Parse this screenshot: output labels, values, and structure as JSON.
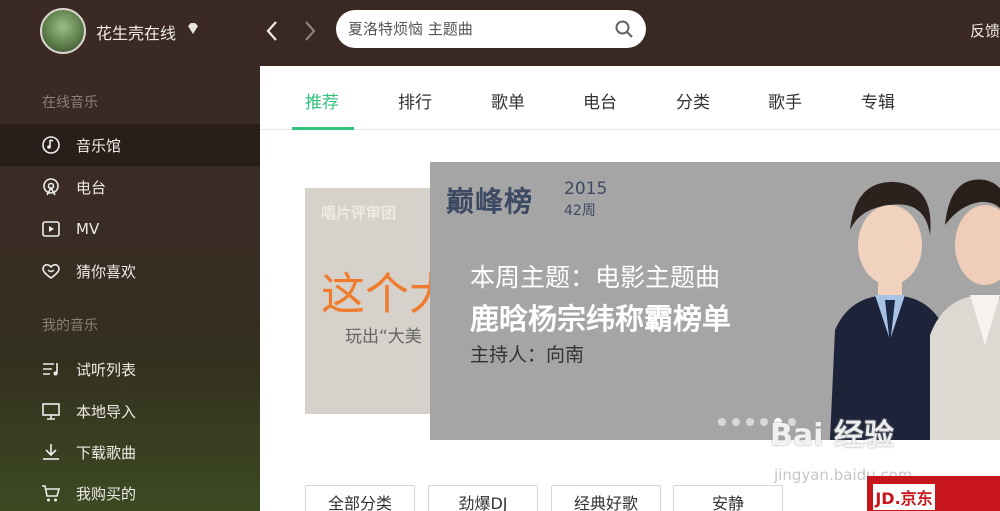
{
  "user": {
    "name": "花生壳在线"
  },
  "sidebar": {
    "sections": [
      {
        "title": "在线音乐",
        "items": [
          {
            "label": "音乐馆",
            "icon": "music-hall-icon",
            "active": true
          },
          {
            "label": "电台",
            "icon": "radio-icon"
          },
          {
            "label": "MV",
            "icon": "mv-icon"
          },
          {
            "label": "猜你喜欢",
            "icon": "heart-icon"
          }
        ]
      },
      {
        "title": "我的音乐",
        "items": [
          {
            "label": "试听列表",
            "icon": "playlist-icon"
          },
          {
            "label": "本地导入",
            "icon": "monitor-icon"
          },
          {
            "label": "下载歌曲",
            "icon": "download-icon"
          },
          {
            "label": "我购买的",
            "icon": "cart-icon"
          }
        ]
      }
    ]
  },
  "search": {
    "placeholder": "夏洛特烦恼 主题曲"
  },
  "header": {
    "feedback": "反馈"
  },
  "tabs": [
    {
      "label": "推荐",
      "active": true
    },
    {
      "label": "排行"
    },
    {
      "label": "歌单"
    },
    {
      "label": "电台"
    },
    {
      "label": "分类"
    },
    {
      "label": "歌手"
    },
    {
      "label": "专辑"
    }
  ],
  "banner": {
    "back": {
      "label1": "唱片评审团",
      "title": "这个大",
      "subtitle": "玩出“大美"
    },
    "front": {
      "brand": "巅峰榜",
      "year": "2015",
      "week": "42周",
      "topic": "本周主题：电影主题曲",
      "headline": "鹿晗杨宗纬称霸榜单",
      "host": "主持人：向南"
    },
    "slide_count": 6,
    "active_slide": 5
  },
  "categories": [
    "全部分类",
    "劲爆DJ",
    "经典好歌",
    "安静"
  ],
  "watermark": {
    "text": "Bai 经验",
    "url": "jingyan.baidu.com"
  },
  "ad": {
    "text": "JD.京东"
  },
  "colors": {
    "accent": "#31c27c",
    "sidebar_bg": "#3b2a24",
    "topbar_bg": "#3a2823"
  }
}
